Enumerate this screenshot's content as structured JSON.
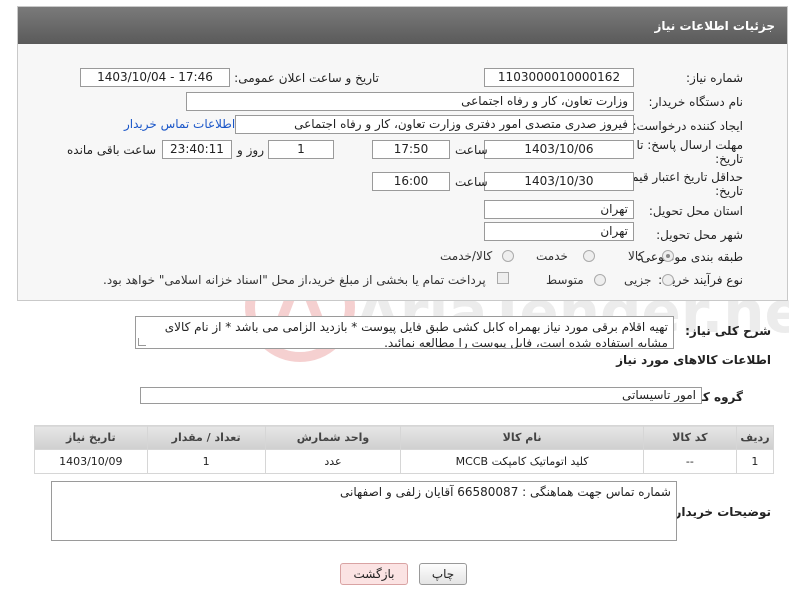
{
  "header": {
    "title": "جزئیات اطلاعات نیاز"
  },
  "form": {
    "need_number_label": "شماره نیاز:",
    "need_number": "1103000010000162",
    "announce_label": "تاریخ و ساعت اعلان عمومی:",
    "announce_value": "1403/10/04 - 17:46",
    "buyer_org_label": "نام دستگاه خریدار:",
    "buyer_org": "وزارت تعاون، کار و رفاه اجتماعی",
    "requester_label": "ایجاد کننده درخواست:",
    "requester": "فیروز صدری متصدی امور دفتری وزارت تعاون، کار و رفاه اجتماعی",
    "buyer_contact_link": "اطلاعات تماس خریدار",
    "deadline_label_1": "مهلت ارسال پاسخ: تا",
    "deadline_label_2": "تاریخ:",
    "deadline_date": "1403/10/06",
    "time_label": "ساعت",
    "deadline_time": "17:50",
    "days_value": "1",
    "days_label": "روز و",
    "remaining_time": "23:40:11",
    "remaining_label": "ساعت باقی مانده",
    "price_validity_label_1": "حداقل تاریخ اعتبار قیمت: تا",
    "price_validity_label_2": "تاریخ:",
    "price_validity_date": "1403/10/30",
    "price_validity_time": "16:00",
    "province_label": "استان محل تحویل:",
    "province": "تهران",
    "city_label": "شهر محل تحویل:",
    "city": "تهران",
    "category_label": "طبقه بندی موضوعی:",
    "category_options": [
      "کالا",
      "خدمت",
      "کالا/خدمت"
    ],
    "category_selected": "کالا",
    "process_label": "نوع فرآیند خرید :",
    "process_options": [
      "جزیی",
      "متوسط"
    ],
    "payment_note": "پرداخت تمام یا بخشی از مبلغ خرید،از محل \"اسناد خزانه اسلامی\" خواهد بود."
  },
  "description": {
    "label": "شرح کلی نیاز:",
    "text": "تهیه اقلام برقی مورد نیاز بهمراه کابل کشی طبق فایل پیوست * بازدید الزامی می باشد * از نام کالای مشابه استفاده شده است، فایل پیوست را مطالعه نمائید."
  },
  "goods": {
    "section_title": "اطلاعات کالاهای مورد نیاز",
    "group_label": "گروه کالا:",
    "group_value": "امور تاسیساتی",
    "columns": [
      "ردیف",
      "کد کالا",
      "نام کالا",
      "واحد شمارش",
      "تعداد / مقدار",
      "تاریخ نیاز"
    ],
    "rows": [
      {
        "index": "1",
        "code": "--",
        "name": "کلید اتوماتیک کامپکت MCCB",
        "unit": "عدد",
        "qty": "1",
        "date": "1403/10/09"
      }
    ]
  },
  "buyer_notes": {
    "label": "توضیحات خریدار:",
    "text": "شماره تماس جهت هماهنگی : 66580087 آقایان زلفی و اصفهانی"
  },
  "buttons": {
    "print": "چاپ",
    "back": "بازگشت"
  },
  "watermark": {
    "text": "AriaTender.neT"
  }
}
